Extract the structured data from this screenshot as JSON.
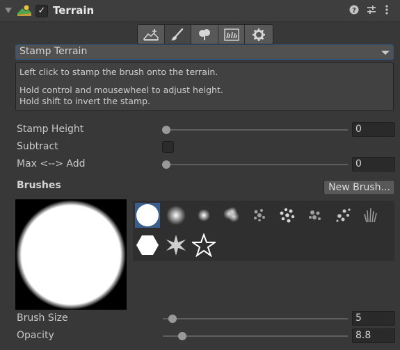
{
  "header": {
    "title": "Terrain",
    "icons": [
      "foldout-arrow-icon",
      "terrain-component-icon",
      "help-icon",
      "presets-icon",
      "kebab-menu-icon"
    ],
    "enabled": true
  },
  "toolbar": {
    "tools": [
      "create-neighbor-terrains-icon",
      "paint-terrain-icon",
      "paint-trees-icon",
      "paint-details-icon",
      "terrain-settings-icon"
    ],
    "active_index": 1
  },
  "tool_dropdown": {
    "selected": "Stamp Terrain"
  },
  "help": {
    "line1": "Left click to stamp the brush onto the terrain.",
    "line2": "Hold control and mousewheel to adjust height.",
    "line3": "Hold shift to invert the stamp."
  },
  "props": {
    "stamp_height": {
      "label": "Stamp Height",
      "value": "0"
    },
    "subtract": {
      "label": "Subtract",
      "checked": false
    },
    "max_add": {
      "label": "Max <--> Add",
      "value": "0"
    }
  },
  "brushes": {
    "label": "Brushes",
    "new_button": "New Brush...",
    "items": [
      "hard-circle",
      "soft-circle",
      "small-soft-circle",
      "cloud",
      "noise-a",
      "noise-b",
      "noise-c",
      "scatter",
      "grass-tuft",
      "hexagon",
      "star-burst",
      "star-outline"
    ],
    "selected_index": 0
  },
  "brush_size": {
    "label": "Brush Size",
    "value": "5"
  },
  "opacity": {
    "label": "Opacity",
    "value": "8.8"
  },
  "colors": {
    "selection": "#3a5f8c",
    "focus_border": "#2a5888",
    "panel": "#383838"
  }
}
